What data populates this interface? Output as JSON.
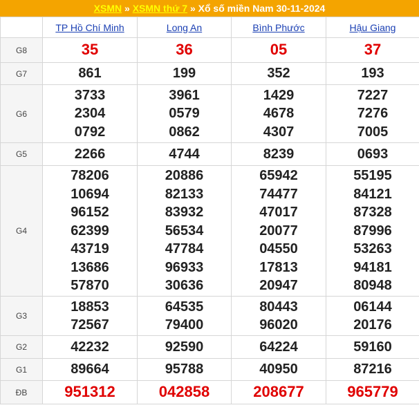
{
  "header": {
    "link1": "XSMN",
    "sep1": "»",
    "link2": "XSMN thứ 7",
    "sep2": "»",
    "title": "Xổ số miền Nam 30-11-2024"
  },
  "provinces": [
    "TP Hồ Chí Minh",
    "Long An",
    "Bình Phước",
    "Hậu Giang"
  ],
  "prizes": [
    {
      "label": "G8",
      "values": [
        [
          "35"
        ],
        [
          "36"
        ],
        [
          "05"
        ],
        [
          "37"
        ]
      ]
    },
    {
      "label": "G7",
      "values": [
        [
          "861"
        ],
        [
          "199"
        ],
        [
          "352"
        ],
        [
          "193"
        ]
      ]
    },
    {
      "label": "G6",
      "values": [
        [
          "3733",
          "2304",
          "0792"
        ],
        [
          "3961",
          "0579",
          "0862"
        ],
        [
          "1429",
          "4678",
          "4307"
        ],
        [
          "7227",
          "7276",
          "7005"
        ]
      ]
    },
    {
      "label": "G5",
      "values": [
        [
          "2266"
        ],
        [
          "4744"
        ],
        [
          "8239"
        ],
        [
          "0693"
        ]
      ]
    },
    {
      "label": "G4",
      "values": [
        [
          "78206",
          "10694",
          "96152",
          "62399",
          "43719",
          "13686",
          "57870"
        ],
        [
          "20886",
          "82133",
          "83932",
          "56534",
          "47784",
          "96933",
          "30636"
        ],
        [
          "65942",
          "74477",
          "47017",
          "20077",
          "04550",
          "17813",
          "20947"
        ],
        [
          "55195",
          "84121",
          "87328",
          "87996",
          "53263",
          "94181",
          "80948"
        ]
      ]
    },
    {
      "label": "G3",
      "values": [
        [
          "18853",
          "72567"
        ],
        [
          "64535",
          "79400"
        ],
        [
          "80443",
          "96020"
        ],
        [
          "06144",
          "20176"
        ]
      ]
    },
    {
      "label": "G2",
      "values": [
        [
          "42232"
        ],
        [
          "92590"
        ],
        [
          "64224"
        ],
        [
          "59160"
        ]
      ]
    },
    {
      "label": "G1",
      "values": [
        [
          "89664"
        ],
        [
          "95788"
        ],
        [
          "40950"
        ],
        [
          "87216"
        ]
      ]
    },
    {
      "label": "ĐB",
      "values": [
        [
          "951312"
        ],
        [
          "042858"
        ],
        [
          "208677"
        ],
        [
          "965779"
        ]
      ]
    }
  ],
  "colors": {
    "header_bg": "#f4a400",
    "header_link": "#ffff00",
    "province_link": "#1a3fb3",
    "special_red": "#e00000"
  }
}
